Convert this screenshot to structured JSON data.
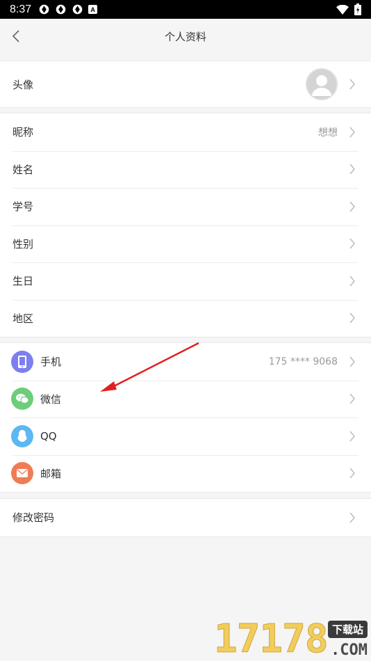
{
  "status_bar": {
    "time": "8:37"
  },
  "header": {
    "title": "个人资料"
  },
  "avatar_row": {
    "label": "头像"
  },
  "profile_rows": [
    {
      "label": "昵称",
      "value": "想想"
    },
    {
      "label": "姓名",
      "value": ""
    },
    {
      "label": "学号",
      "value": ""
    },
    {
      "label": "性别",
      "value": ""
    },
    {
      "label": "生日",
      "value": ""
    },
    {
      "label": "地区",
      "value": ""
    }
  ],
  "bindings": [
    {
      "label": "手机",
      "value": "175 **** 9068",
      "icon": "phone-icon",
      "color": "#7b7ff0"
    },
    {
      "label": "微信",
      "value": "",
      "icon": "wechat-icon",
      "color": "#6dcd7a"
    },
    {
      "label": "QQ",
      "value": "",
      "icon": "qq-icon",
      "color": "#5cb8f2"
    },
    {
      "label": "邮箱",
      "value": "",
      "icon": "mail-icon",
      "color": "#f07c55"
    }
  ],
  "password_row": {
    "label": "修改密码"
  },
  "watermark": {
    "number": "17178",
    "tag": "下载站",
    "domain": ".COM"
  },
  "colors": {
    "background": "#f5f5f5",
    "annotation_arrow": "#e02020"
  }
}
